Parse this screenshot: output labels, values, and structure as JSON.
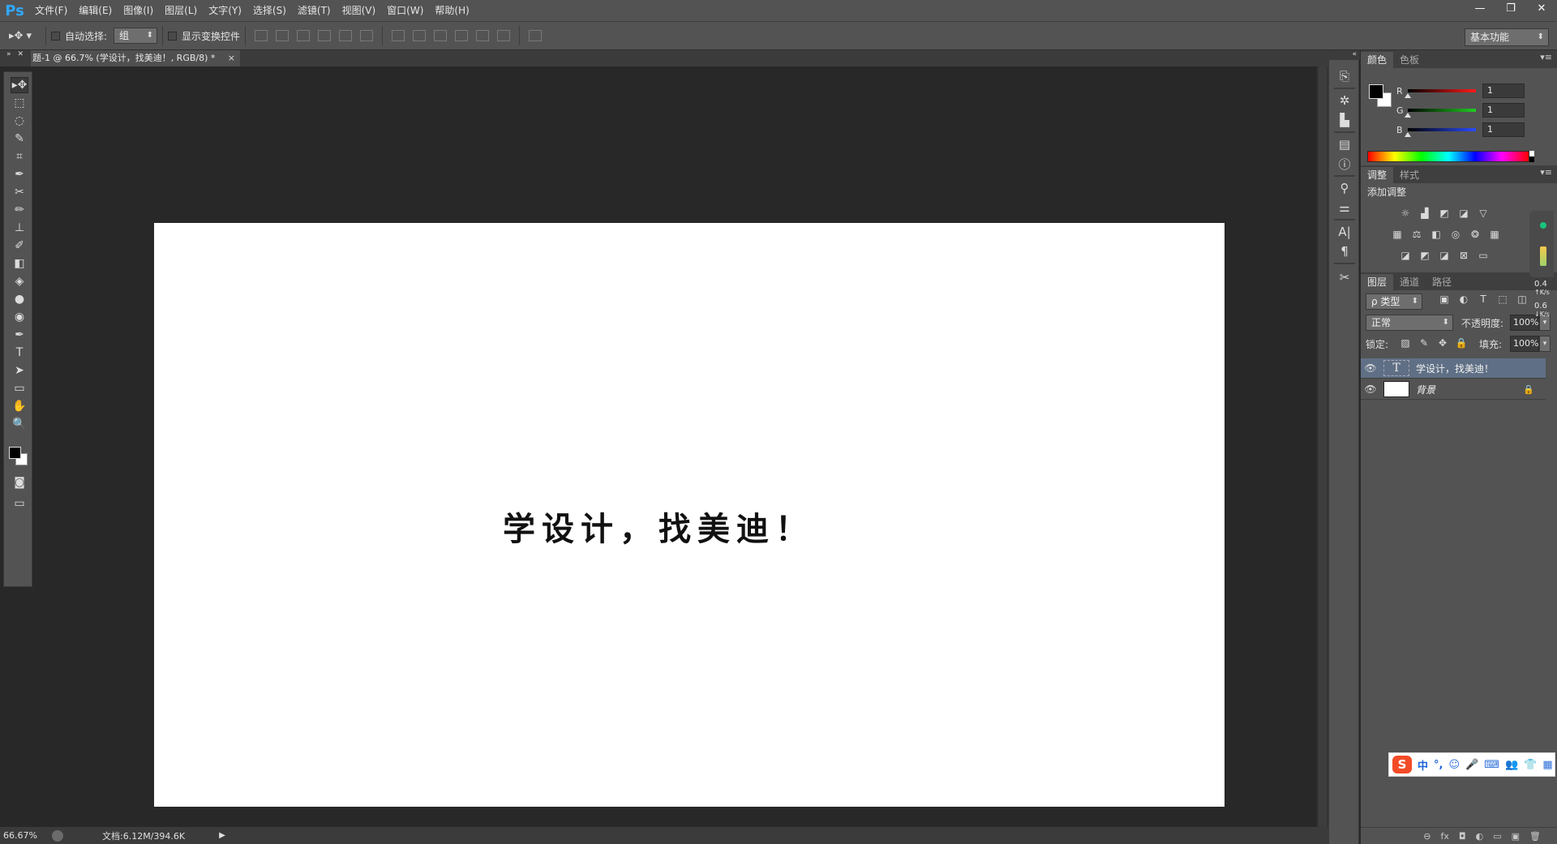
{
  "app": {
    "logo": "Ps",
    "window_controls": [
      "—",
      "❐",
      "✕"
    ]
  },
  "menu": [
    "文件(F)",
    "编辑(E)",
    "图像(I)",
    "图层(L)",
    "文字(Y)",
    "选择(S)",
    "滤镜(T)",
    "视图(V)",
    "窗口(W)",
    "帮助(H)"
  ],
  "options": {
    "auto_select_label": "自动选择:",
    "auto_select_value": "组",
    "show_transform_label": "显示变换控件",
    "workspace": "基本功能"
  },
  "document": {
    "tab_title": "题-1 @ 66.7% (学设计，找美迪！, RGB/8) *",
    "tab_close": "×",
    "canvas_text": "学设计，找美迪！"
  },
  "toolbar": {
    "tools": [
      {
        "name": "move-tool",
        "glyph": "▸✥"
      },
      {
        "name": "marquee-tool",
        "glyph": "⬚"
      },
      {
        "name": "lasso-tool",
        "glyph": "◌"
      },
      {
        "name": "quick-select-tool",
        "glyph": "✎"
      },
      {
        "name": "crop-tool",
        "glyph": "⌗"
      },
      {
        "name": "eyedropper-tool",
        "glyph": "✒"
      },
      {
        "name": "healing-tool",
        "glyph": "✂"
      },
      {
        "name": "brush-tool",
        "glyph": "✏"
      },
      {
        "name": "stamp-tool",
        "glyph": "⊥"
      },
      {
        "name": "history-brush-tool",
        "glyph": "✐"
      },
      {
        "name": "eraser-tool",
        "glyph": "◧"
      },
      {
        "name": "paint-bucket-tool",
        "glyph": "◈"
      },
      {
        "name": "blur-tool",
        "glyph": "●"
      },
      {
        "name": "dodge-tool",
        "glyph": "◉"
      },
      {
        "name": "pen-tool",
        "glyph": "✒"
      },
      {
        "name": "type-tool",
        "glyph": "T"
      },
      {
        "name": "path-select-tool",
        "glyph": "➤"
      },
      {
        "name": "shape-tool",
        "glyph": "▭"
      },
      {
        "name": "hand-tool",
        "glyph": "✋"
      },
      {
        "name": "zoom-tool",
        "glyph": "🔍"
      }
    ]
  },
  "color_panel": {
    "tabs": [
      "颜色",
      "色板"
    ],
    "sliders": [
      {
        "label": "R",
        "value": "1",
        "color": "#ff1a1a"
      },
      {
        "label": "G",
        "value": "1",
        "color": "#22cc22"
      },
      {
        "label": "B",
        "value": "1",
        "color": "#2a4bff"
      }
    ]
  },
  "adjustments_panel": {
    "tabs": [
      "调整",
      "样式"
    ],
    "title": "添加调整"
  },
  "layers_panel": {
    "tabs": [
      "图层",
      "通道",
      "路径"
    ],
    "filter": "ρ 类型",
    "blend_mode": "正常",
    "opacity_label": "不透明度:",
    "opacity_value": "100%",
    "lock_label": "锁定:",
    "fill_label": "填充:",
    "fill_value": "100%",
    "layers": [
      {
        "name": "学设计，找美迪！",
        "type": "text",
        "selected": true,
        "thumb": "T"
      },
      {
        "name": "背景",
        "type": "background",
        "selected": false,
        "thumb": ""
      }
    ],
    "footer_icons": [
      "⊖",
      "fx",
      "◘",
      "◐",
      "▭",
      "▣",
      "🗑"
    ]
  },
  "status": {
    "zoom": "66.67%",
    "doc_info": "文档:6.12M/394.6K",
    "arrow": "▶"
  },
  "side_widget": {
    "upload_speed": "0.4",
    "upload_unit": "K/s",
    "download_speed": "0.6",
    "download_unit": "K/s"
  },
  "ime": {
    "logo": "S",
    "mode": "中",
    "punct": "°,"
  }
}
